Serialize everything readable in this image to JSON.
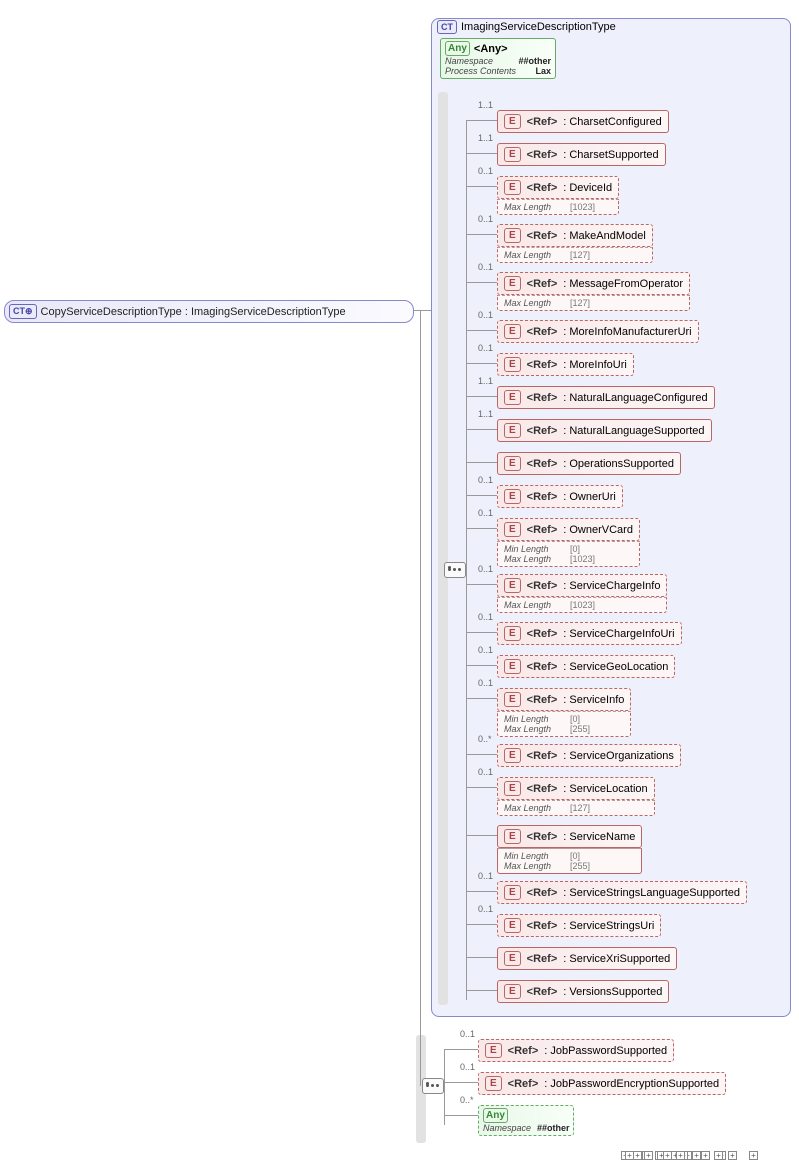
{
  "root": {
    "label": "CopyServiceDescriptionType : ImagingServiceDescriptionType",
    "badge": "CT⊕"
  },
  "inner": {
    "title": "ImagingServiceDescriptionType",
    "badge": "CT",
    "any": {
      "title": "<Any>",
      "ns_label": "Namespace",
      "ns_val": "##other",
      "pc_label": "Process Contents",
      "pc_val": "Lax"
    }
  },
  "ref_label": "<Ref>",
  "any_label": "<Any>",
  "maxlen_label": "Max Length",
  "minlen_label": "Min Length",
  "ns_label": "Namespace",
  "elements_inner": [
    {
      "name": "CharsetConfigured",
      "card": "1..1",
      "dashed": false,
      "expand": true
    },
    {
      "name": "CharsetSupported",
      "card": "1..1",
      "dashed": false,
      "expand": true
    },
    {
      "name": "DeviceId",
      "card": "0..1",
      "dashed": true,
      "meta": [
        [
          "Max Length",
          "[1023]"
        ]
      ],
      "expand": true
    },
    {
      "name": "MakeAndModel",
      "card": "0..1",
      "dashed": true,
      "meta": [
        [
          "Max Length",
          "[127]"
        ]
      ],
      "expand": true
    },
    {
      "name": "MessageFromOperator",
      "card": "0..1",
      "dashed": true,
      "meta": [
        [
          "Max Length",
          "[127]"
        ]
      ],
      "expand": true
    },
    {
      "name": "MoreInfoManufacturerUri",
      "card": "0..1",
      "dashed": true,
      "expand": true
    },
    {
      "name": "MoreInfoUri",
      "card": "0..1",
      "dashed": true,
      "expand": true
    },
    {
      "name": "NaturalLanguageConfigured",
      "card": "1..1",
      "dashed": false,
      "expand": true
    },
    {
      "name": "NaturalLanguageSupported",
      "card": "1..1",
      "dashed": false,
      "expand": true
    },
    {
      "name": "OperationsSupported",
      "card": "",
      "dashed": false,
      "expand": true
    },
    {
      "name": "OwnerUri",
      "card": "0..1",
      "dashed": true,
      "expand": true
    },
    {
      "name": "OwnerVCard",
      "card": "0..1",
      "dashed": true,
      "meta": [
        [
          "Min Length",
          "[0]"
        ],
        [
          "Max Length",
          "[1023]"
        ]
      ],
      "expand": true
    },
    {
      "name": "ServiceChargeInfo",
      "card": "0..1",
      "dashed": true,
      "meta": [
        [
          "Max Length",
          "[1023]"
        ]
      ],
      "expand": true
    },
    {
      "name": "ServiceChargeInfoUri",
      "card": "0..1",
      "dashed": true,
      "expand": true
    },
    {
      "name": "ServiceGeoLocation",
      "card": "0..1",
      "dashed": true,
      "expand": true
    },
    {
      "name": "ServiceInfo",
      "card": "0..1",
      "dashed": true,
      "meta": [
        [
          "Min Length",
          "[0]"
        ],
        [
          "Max Length",
          "[255]"
        ]
      ],
      "expand": true
    },
    {
      "name": "ServiceOrganizations",
      "card": "0..*",
      "dashed": true,
      "expand": true
    },
    {
      "name": "ServiceLocation",
      "card": "0..1",
      "dashed": true,
      "meta": [
        [
          "Max Length",
          "[127]"
        ]
      ],
      "expand": true
    },
    {
      "name": "ServiceName",
      "card": "",
      "dashed": false,
      "meta": [
        [
          "Min Length",
          "[0]"
        ],
        [
          "Max Length",
          "[255]"
        ]
      ],
      "expand": true
    },
    {
      "name": "ServiceStringsLanguageSupported",
      "card": "0..1",
      "dashed": true,
      "expand": true
    },
    {
      "name": "ServiceStringsUri",
      "card": "0..1",
      "dashed": true,
      "expand": true
    },
    {
      "name": "ServiceXriSupported",
      "card": "",
      "dashed": false,
      "expand": true
    },
    {
      "name": "VersionsSupported",
      "card": "",
      "dashed": false,
      "expand": true
    }
  ],
  "elements_outer": [
    {
      "name": "JobPasswordSupported",
      "card": "0..1",
      "dashed": true,
      "expand": true
    },
    {
      "name": "JobPasswordEncryptionSupported",
      "card": "0..1",
      "dashed": true,
      "expand": true
    }
  ],
  "outer_any": {
    "card": "0..*",
    "ns_val": "##other"
  }
}
